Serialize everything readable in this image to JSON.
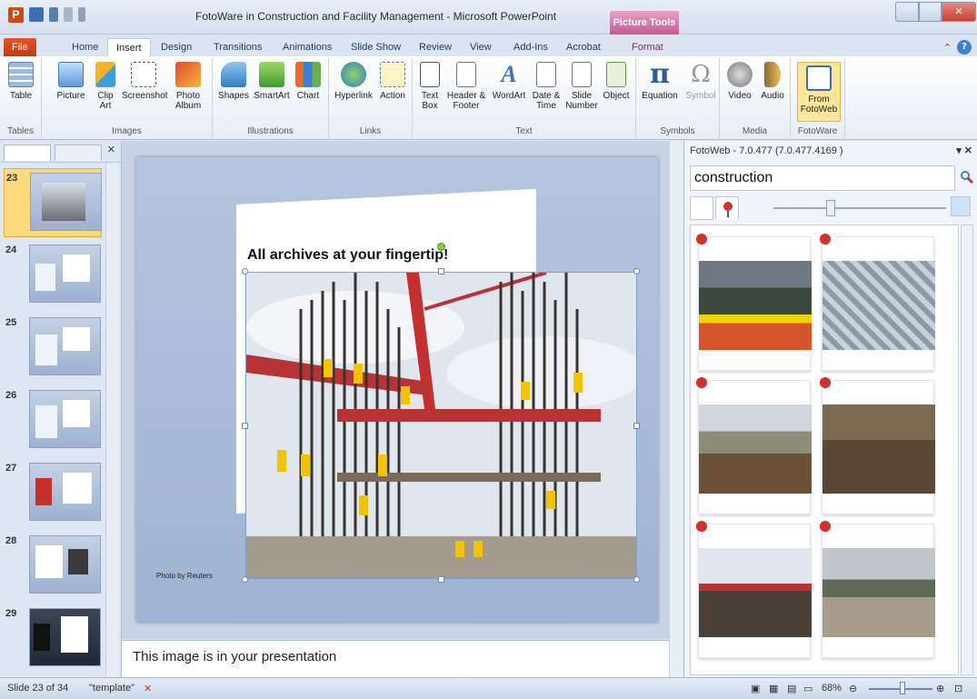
{
  "window": {
    "app_icon": "P",
    "title": "FotoWare in Construction and Facility Management - Microsoft PowerPoint",
    "picture_tools_label": "Picture Tools"
  },
  "ribbon_tabs": [
    "File",
    "Home",
    "Insert",
    "Design",
    "Transitions",
    "Animations",
    "Slide Show",
    "Review",
    "View",
    "Add-Ins",
    "Acrobat",
    "Format"
  ],
  "ribbon": {
    "tables": {
      "label": "Tables",
      "table": "Table"
    },
    "images": {
      "label": "Images",
      "picture": "Picture",
      "clip_art": "Clip Art",
      "screenshot": "Screenshot",
      "photo_album": "Photo Album"
    },
    "illustrations": {
      "label": "Illustrations",
      "shapes": "Shapes",
      "smartart": "SmartArt",
      "chart": "Chart"
    },
    "links": {
      "label": "Links",
      "hyperlink": "Hyperlink",
      "action": "Action"
    },
    "text": {
      "label": "Text",
      "text_box": "Text Box",
      "header_footer": "Header & Footer",
      "wordart": "WordArt",
      "date_time": "Date & Time",
      "slide_number": "Slide Number",
      "object": "Object"
    },
    "symbols": {
      "label": "Symbols",
      "equation": "Equation",
      "symbol": "Symbol"
    },
    "media": {
      "label": "Media",
      "video": "Video",
      "audio": "Audio"
    },
    "fotoware": {
      "label": "FotoWare",
      "from_fotoweb": "From FotoWeb"
    }
  },
  "slides": [
    {
      "number": "23",
      "selected": true
    },
    {
      "number": "24"
    },
    {
      "number": "25"
    },
    {
      "number": "26"
    },
    {
      "number": "27"
    },
    {
      "number": "28"
    },
    {
      "number": "29"
    }
  ],
  "slide": {
    "title": "All archives at your fingertip!",
    "photo_credit": "Photo by Reuters"
  },
  "notes": {
    "text": "This image is in your presentation"
  },
  "fotoweb": {
    "header": "FotoWeb - 7.0.477 (7.0.477.4169 )",
    "search_value": "construction",
    "tiles": [
      "construction-photo-1",
      "construction-photo-2",
      "construction-photo-3",
      "construction-photo-4",
      "construction-photo-5",
      "construction-photo-6"
    ]
  },
  "status": {
    "slide_info": "Slide 23 of 34",
    "theme": "\"template\"",
    "zoom": "68%"
  },
  "colors": {
    "file_tab": "#c43b13",
    "picture_tools": "#c65b95",
    "selected_slide": "#fdd97d"
  }
}
